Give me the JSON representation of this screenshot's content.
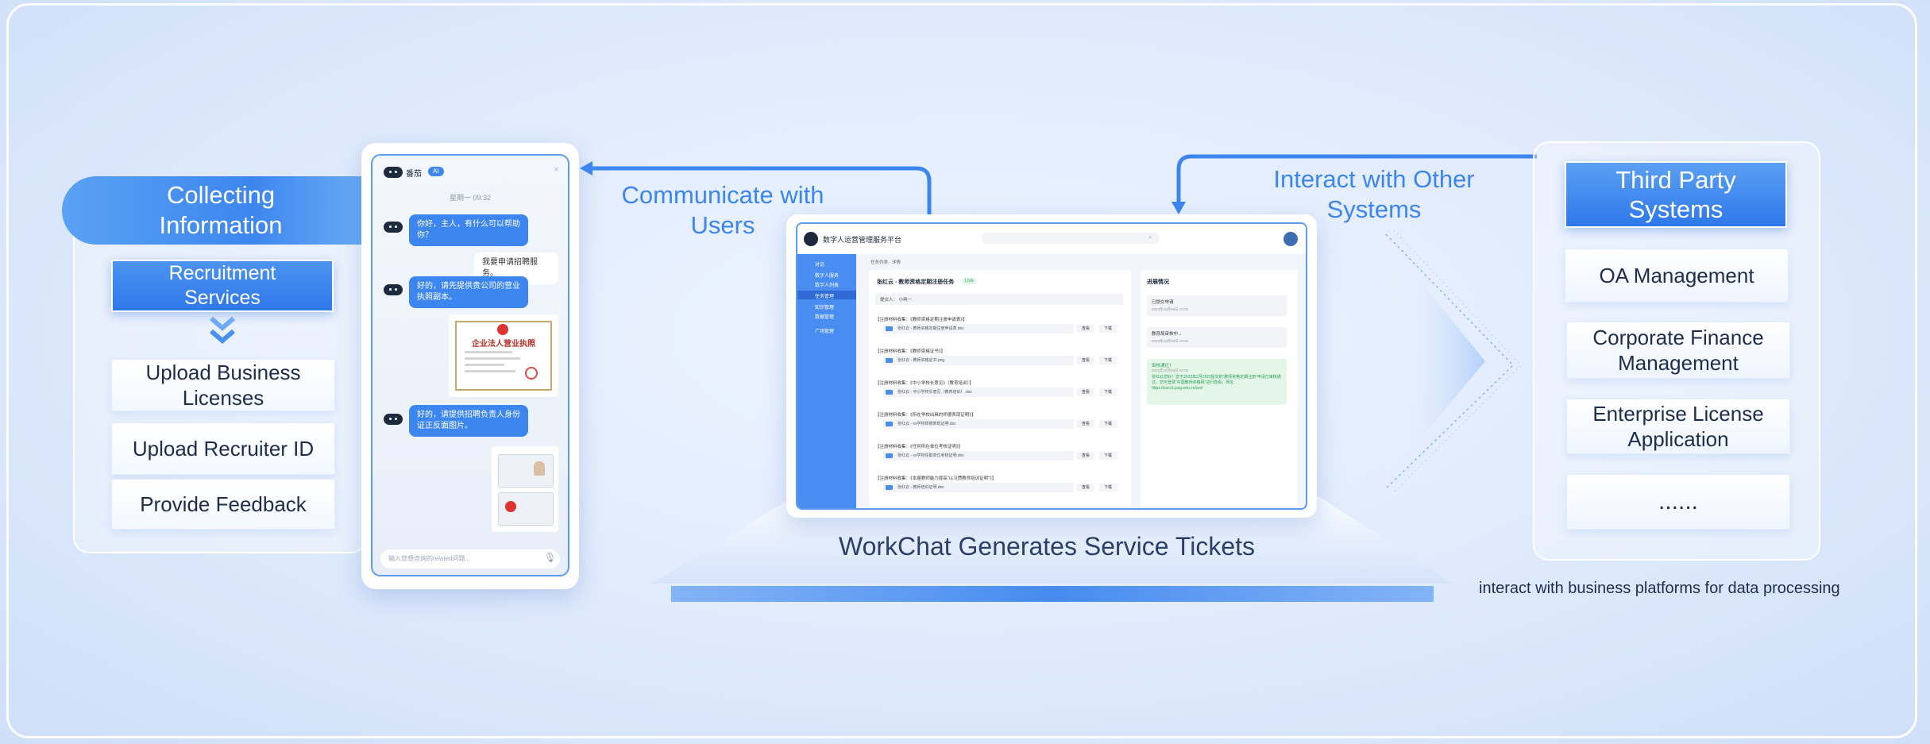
{
  "left": {
    "title": "Collecting Information",
    "recruitment": "Recruitment Services",
    "steps": [
      "Upload Business Licenses",
      "Upload Recruiter ID",
      "Provide Feedback"
    ]
  },
  "phone": {
    "bot_name": "番茄",
    "bot_badge": "AI",
    "time": "星期一 09:32",
    "msg1": "你好，主人，有什么可以帮助你？",
    "msg2": "我要申请招聘服务。",
    "msg3": "好的，请先提供贵公司的营业执照副本。",
    "license_title": "企业法人营业执照",
    "msg4": "好的，请提供招聘负责人身份证正反面图片。",
    "input_placeholder": "输入您想咨询的related问题..."
  },
  "arrows": {
    "communicate": "Communicate with Users",
    "interact": "Interact with Other Systems"
  },
  "laptop": {
    "app_title": "数字人运营管理服务平台",
    "breadcrumb": "任务列表 · 详情",
    "ticket_title": "张红云 - 教师资格定期注册任务",
    "status_badge": "LIVE",
    "submitter": "提交人：  小冉一",
    "progress_title": "进展情况",
    "sidebar": [
      "对话",
      "数字人服务",
      "数字人列表",
      "任务管理",
      "知识管理",
      "数据管理",
      "广场管理"
    ],
    "rows": [
      {
        "title": "【注册材料收集：《教师资格定期注册申请表》】",
        "file": "张红云 - 教师资格定期注册申请表.doc"
      },
      {
        "title": "【注册材料收集：《教师资格证书》】",
        "file": "张红云 - 教师资格证书.png"
      },
      {
        "title": "【注册材料收集：《中小学校长意见》（教育培训）】",
        "file": "张红云 - 中小学校长意见（教育培训）.doc"
      },
      {
        "title": "【注册材料收集：《所在学校出具的师德表现证明》】",
        "file": "张红云 - xx学校师德表现证明.doc"
      },
      {
        "title": "【注册材料收集：《任何所在单位考核证明》】",
        "file": "张红云 - xx学校任职单位考核证明.doc"
      },
      {
        "title": "【注册材料收集：《本届教师能力提高“以习惯教师培训证明”》】",
        "file": "张红云 - 教师培训证明.doc"
      }
    ],
    "btn_view": "查看",
    "btn_download": "下载",
    "progress_items": [
      "已提交申请",
      "教育局审核中..."
    ],
    "progress_date": "2023年10月08日  10:06",
    "notice_title": "审核通过！",
    "notice_text": "张红云您好！您于2023年2月25日提交的“教师资格定期注册”申请已审核通过，您可登录“中国教师资格网”进行查看，网址https://zscx1.jszg.edu.cn/xxx/"
  },
  "center_caption": "WorkChat Generates Service Tickets",
  "right": {
    "title": "Third Party Systems",
    "items": [
      "OA Management",
      "Corporate Finance Management",
      "Enterprise License Application",
      "......"
    ]
  },
  "footnote": "interact with business platforms for data processing",
  "colors": {
    "accent": "#3d86ef",
    "text_dark": "#1f2d4d"
  }
}
